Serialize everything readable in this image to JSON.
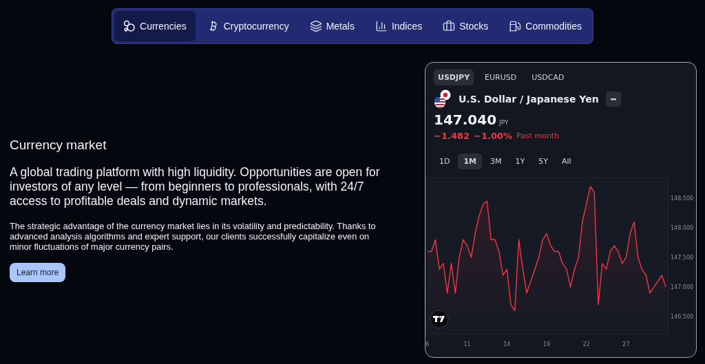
{
  "nav": {
    "items": [
      {
        "label": "Currencies",
        "kind": "circles",
        "selected": true
      },
      {
        "label": "Cryptocurrency",
        "kind": "bitcoin",
        "selected": false
      },
      {
        "label": "Metals",
        "kind": "layers",
        "selected": false
      },
      {
        "label": "Indices",
        "kind": "bars",
        "selected": false
      },
      {
        "label": "Stocks",
        "kind": "briefcase",
        "selected": false
      },
      {
        "label": "Commodities",
        "kind": "fuel",
        "selected": false
      }
    ]
  },
  "intro": {
    "title": "Currency market",
    "lead": "A global trading platform with high liquidity. Opportunities are open for investors of any level — from beginners to professionals, with 24/7 access to profitable deals and dynamic markets.",
    "body": "The strategic advantage of the currency market lies in its volatility and predictability. Thanks to advanced analysis algorithms and expert support, our clients successfully capitalize even on minor fluctuations of major currency pairs.",
    "button": "Learn more"
  },
  "widget": {
    "pairs": [
      {
        "label": "USDJPY",
        "selected": true
      },
      {
        "label": "EURUSD",
        "selected": false
      },
      {
        "label": "USDCAD",
        "selected": false
      }
    ],
    "name": "U.S. Dollar / Japanese Yen",
    "price": "147.040",
    "currency": "JPY",
    "change": "−1.482",
    "change_percent": "−1.00%",
    "period": "Past month",
    "ranges": [
      {
        "label": "1D",
        "selected": false
      },
      {
        "label": "1M",
        "selected": true
      },
      {
        "label": "3M",
        "selected": false
      },
      {
        "label": "1Y",
        "selected": false
      },
      {
        "label": "5Y",
        "selected": false
      },
      {
        "label": "All",
        "selected": false
      }
    ],
    "chart_data": {
      "type": "area",
      "categories": [
        "6",
        null,
        null,
        null,
        null,
        null,
        null,
        null,
        null,
        null,
        "11",
        null,
        null,
        null,
        null,
        null,
        null,
        null,
        null,
        null,
        "14",
        null,
        null,
        null,
        null,
        null,
        null,
        null,
        null,
        null,
        "19",
        null,
        null,
        null,
        null,
        null,
        null,
        null,
        null,
        null,
        "22",
        null,
        null,
        null,
        null,
        null,
        null,
        null,
        null,
        null,
        "27",
        null,
        null,
        null,
        null,
        null,
        null,
        null,
        null,
        null,
        null
      ],
      "series": [
        {
          "color": "#f23645",
          "values": [
            147.6,
            147.6,
            147.8,
            147.3,
            147.4,
            146.9,
            147.4,
            146.9,
            147.5,
            147.8,
            147.7,
            147.5,
            147.9,
            148.2,
            148.4,
            148.45,
            147.8,
            147.8,
            147.6,
            147.2,
            147.3,
            146.7,
            146.6,
            147.8,
            147.3,
            146.9,
            147.1,
            147.3,
            147.5,
            147.8,
            147.9,
            147.7,
            147.6,
            147.6,
            147.4,
            147.3,
            147.0,
            147.3,
            147.5,
            148.1,
            148.4,
            148.7,
            148.6,
            146.7,
            147.4,
            147.3,
            147.6,
            147.7,
            147.6,
            147.4,
            147.5,
            147.9,
            148.1,
            147.5,
            147.3,
            147.2,
            146.9,
            147.0,
            147.1,
            147.2,
            147.0
          ]
        }
      ],
      "ylim": [
        146.2,
        148.85
      ],
      "yticks": [
        {
          "value": 146.5,
          "label": "146.500"
        },
        {
          "value": 147,
          "label": "147.000"
        },
        {
          "value": 147.5,
          "label": "147.500"
        },
        {
          "value": 148,
          "label": "148.000"
        },
        {
          "value": 148.5,
          "label": "148.500"
        }
      ]
    }
  }
}
